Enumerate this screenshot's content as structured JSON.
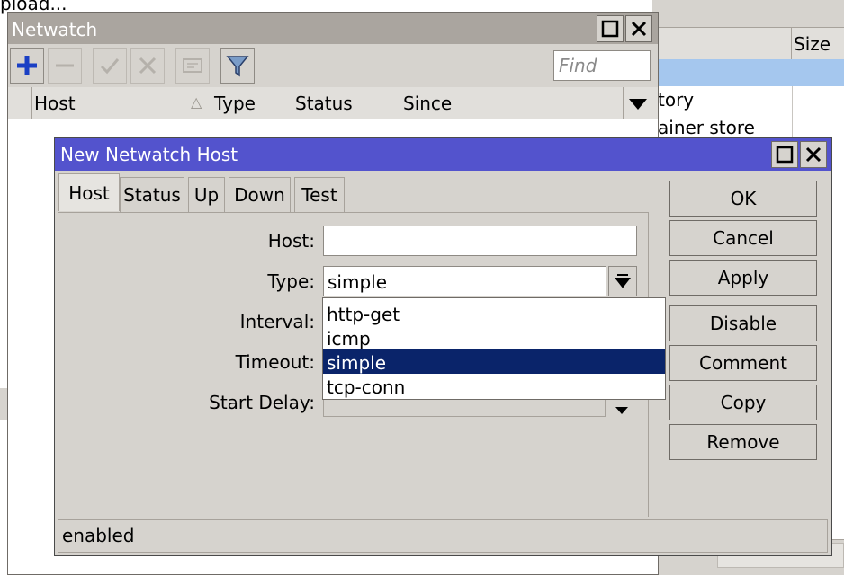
{
  "background_window": {
    "top_text": "pload...",
    "size_header": "Size",
    "rows": [
      "tory",
      "ainer store"
    ]
  },
  "netwatch": {
    "title": "Netwatch",
    "find_placeholder": "Find",
    "columns": [
      "Host",
      "Type",
      "Status",
      "Since"
    ],
    "toolbar_icons": [
      "plus-icon",
      "minus-icon",
      "check-icon",
      "x-icon",
      "comment-icon",
      "filter-icon"
    ]
  },
  "dialog": {
    "title": "New Netwatch Host",
    "tabs": [
      "Host",
      "Status",
      "Up",
      "Down",
      "Test"
    ],
    "active_tab": "Host",
    "fields": {
      "host_label": "Host:",
      "host_value": "",
      "type_label": "Type:",
      "type_value": "simple",
      "interval_label": "Interval:",
      "timeout_label": "Timeout:",
      "start_delay_label": "Start Delay:"
    },
    "type_options": [
      "http-get",
      "icmp",
      "simple",
      "tcp-conn"
    ],
    "selected_option": "simple",
    "buttons": {
      "ok": "OK",
      "cancel": "Cancel",
      "apply": "Apply",
      "disable": "Disable",
      "comment": "Comment",
      "copy": "Copy",
      "remove": "Remove"
    },
    "status": "enabled"
  },
  "colors": {
    "dialog_title_bar": "#5353cd",
    "inactive_title_bar": "#aaa59f",
    "selection": "#0a246a",
    "background_selection": "#a5c7ee",
    "add_icon": "#1a3fc4"
  }
}
